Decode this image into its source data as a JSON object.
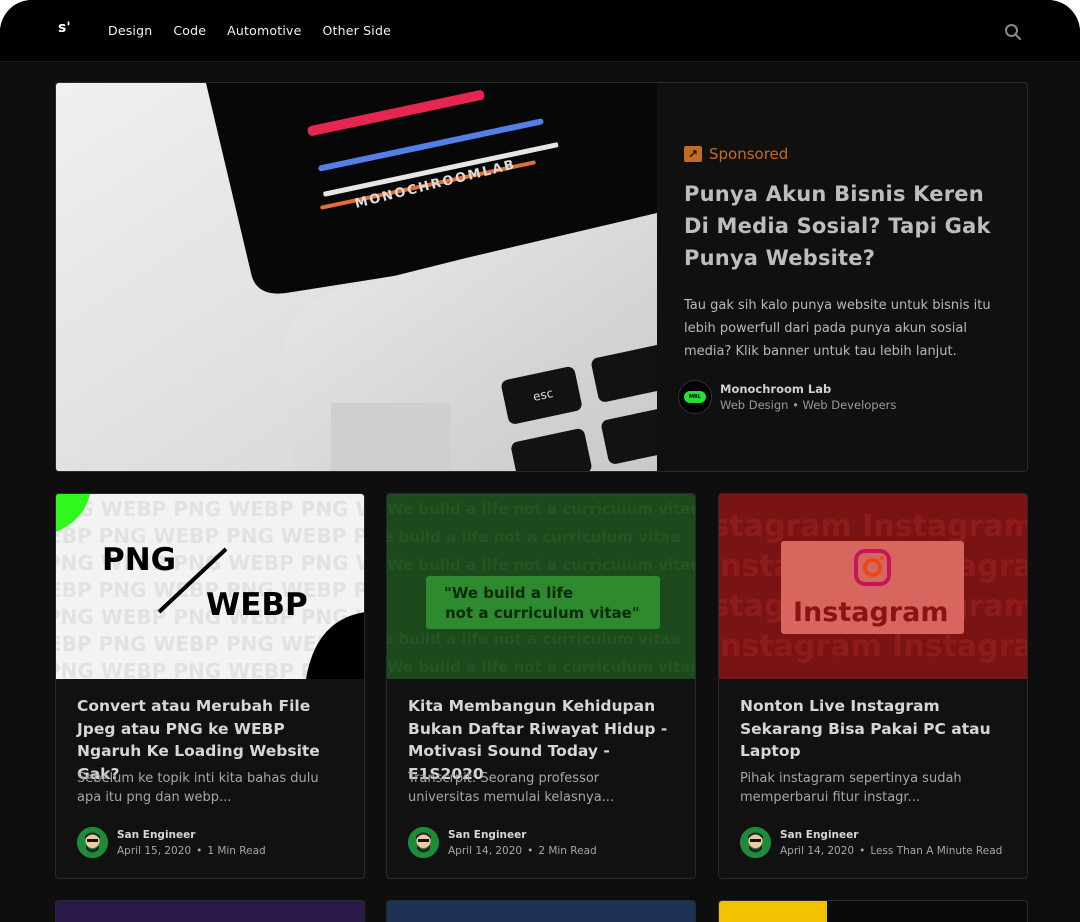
{
  "nav": {
    "logo": "s'",
    "links": [
      "Design",
      "Code",
      "Automotive",
      "Other Side"
    ]
  },
  "hero": {
    "image_text": "MONOCHROOMLAB",
    "key_labels": [
      "esc"
    ],
    "badge": "Sponsored",
    "title": "Punya Akun Bisnis Keren Di Media Sosial? Tapi Gak Punya Website?",
    "description": "Tau gak sih kalo punya website untuk bisnis itu lebih powerfull dari pada punya akun sosial media? Klik banner untuk tau lebih lanjut.",
    "author": "Monochroom Lab",
    "author_sub": "Web Design • Web Developers",
    "avatar_text": "MRL"
  },
  "cards": [
    {
      "thumb_text_a": "PNG",
      "thumb_text_b": "WEBP",
      "title": "Convert atau Merubah File Jpeg atau PNG ke WEBP Ngaruh Ke Loading Website Gak?",
      "excerpt": "Sebelum ke topik inti kita bahas dulu apa itu png dan webp...",
      "author": "San Engineer",
      "date": "April 15, 2020",
      "read": "1 Min Read"
    },
    {
      "thumb_line1": "\"We build a life",
      "thumb_line2": "not a curriculum vitae\"",
      "title": "Kita Membangun Kehidupan Bukan Daftar Riwayat Hidup - Motivasi Sound Today - E1S2020",
      "excerpt": "Transcrpit: Seorang professor universitas memulai kelasnya...",
      "author": "San Engineer",
      "date": "April 14, 2020",
      "read": "2 Min Read"
    },
    {
      "thumb_text": "Instagram",
      "title": "Nonton Live Instagram Sekarang Bisa Pakai PC atau Laptop",
      "excerpt": "Pihak instagram sepertinya sudah memperbarui fitur instagr...",
      "author": "San Engineer",
      "date": "April 14, 2020",
      "read": "Less Than A Minute Read"
    }
  ],
  "colors": {
    "accent_orange": "#c66a1e",
    "bg": "#0e0e0e",
    "green_brand": "#22e334"
  },
  "icons": [
    "search-icon",
    "arrow-up-right-icon"
  ]
}
